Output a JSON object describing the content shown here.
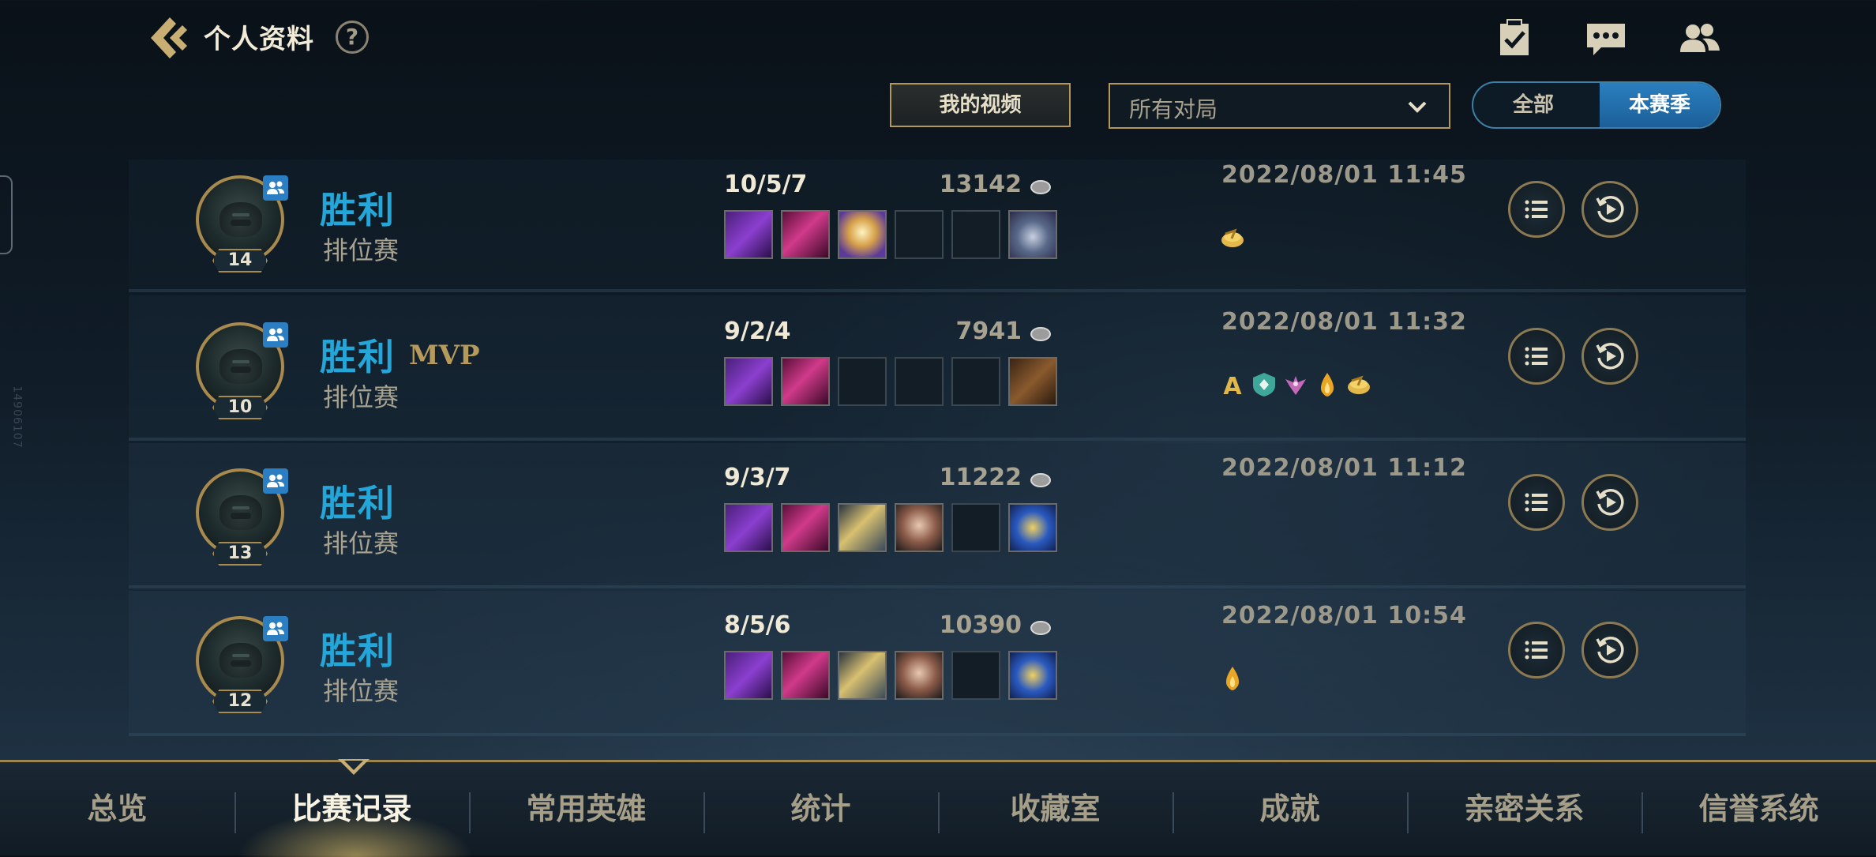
{
  "header": {
    "title": "个人资料",
    "help": "?"
  },
  "toolbar": {
    "video_label": "我的视频",
    "filter": {
      "selected": "所有对局"
    },
    "season_toggle": {
      "all_label": "全部",
      "season_label": "本赛季",
      "active": "本赛季"
    }
  },
  "matches": [
    {
      "result": "胜利",
      "mvp": "",
      "mode": "排位赛",
      "level": "14",
      "kda": "10/5/7",
      "gold": "13142",
      "datetime": "2022/08/01 11:45",
      "items": [
        "purple-tower-item",
        "magenta-blade-item",
        "winged-gold-item",
        "empty",
        "empty",
        "shadow-ward-trinket"
      ],
      "badges": [
        "gold-coin-icon"
      ]
    },
    {
      "result": "胜利",
      "mvp": "MVP",
      "mode": "排位赛",
      "level": "10",
      "kda": "9/2/4",
      "gold": "7941",
      "datetime": "2022/08/01 11:32",
      "items": [
        "purple-tower-item",
        "magenta-blade-item",
        "empty",
        "empty",
        "empty",
        "leather-boots-item"
      ],
      "badges": [
        "a-grade-icon",
        "shield-icon",
        "winged-icon",
        "flame-drop-icon",
        "gold-coin-icon"
      ]
    },
    {
      "result": "胜利",
      "mvp": "",
      "mode": "排位赛",
      "level": "13",
      "kda": "9/3/7",
      "gold": "11222",
      "datetime": "2022/08/01 11:12",
      "items": [
        "purple-tower-item",
        "magenta-blade-item",
        "gold-spear-item",
        "rock-armor-item",
        "empty",
        "blue-lantern-trinket"
      ],
      "badges": []
    },
    {
      "result": "胜利",
      "mvp": "",
      "mode": "排位赛",
      "level": "12",
      "kda": "8/5/6",
      "gold": "10390",
      "datetime": "2022/08/01 10:54",
      "items": [
        "purple-tower-item",
        "magenta-blade-item",
        "gold-spear-item",
        "rock-armor-item",
        "empty",
        "blue-lantern-trinket"
      ],
      "badges": [
        "flame-drop-icon"
      ]
    }
  ],
  "nav": {
    "tabs": [
      "总览",
      "比赛记录",
      "常用英雄",
      "统计",
      "收藏室",
      "成就",
      "亲密关系",
      "信誉系统"
    ],
    "active": "比赛记录"
  },
  "colors": {
    "accent_gold": "#b5975a",
    "win_blue": "#24a7d8",
    "toggle_blue": "#2a7fbf"
  },
  "side_code": "14906107"
}
